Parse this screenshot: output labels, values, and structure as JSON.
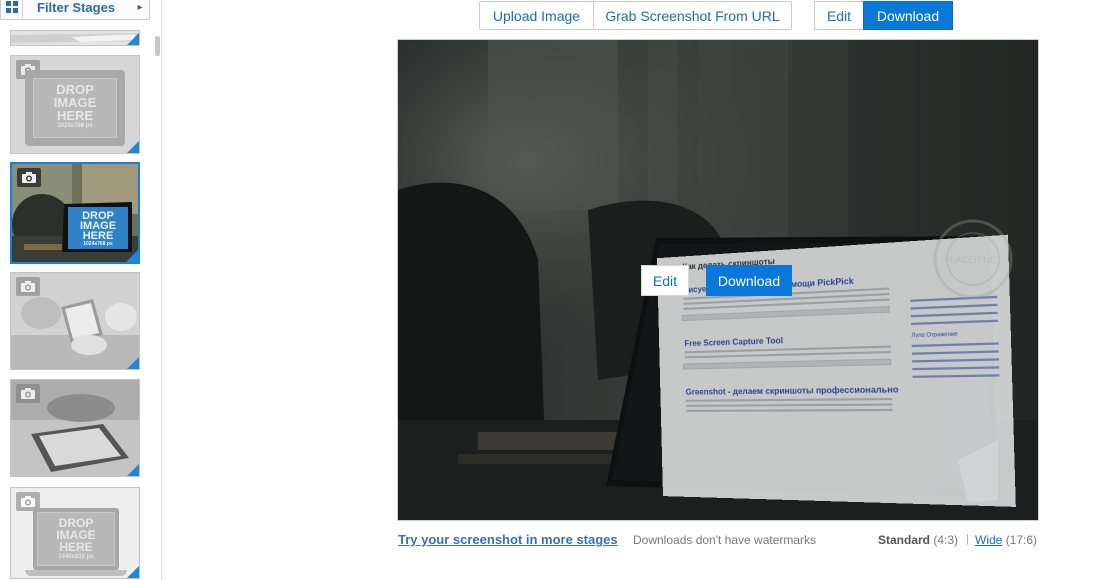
{
  "sidebar": {
    "filter_label": "Filter Stages",
    "filter_icon": "grid-icon",
    "filter_chevron": "chevron-right-icon",
    "placeholder": {
      "line1": "DROP",
      "line2": "IMAGE",
      "line3": "HERE"
    },
    "stages": [
      {
        "dims": "1024x768 px",
        "selected": false
      },
      {
        "dims": "1024x768 px",
        "selected": true
      },
      {
        "dims": "",
        "selected": false
      },
      {
        "dims": "",
        "selected": false
      },
      {
        "dims": "1440x810 px",
        "selected": false
      }
    ]
  },
  "toolbar": {
    "upload_label": "Upload Image",
    "grab_label": "Grab Screenshot From URL",
    "edit_label": "Edit",
    "download_label": "Download"
  },
  "preview": {
    "overlay_edit_label": "Edit",
    "overlay_download_label": "Download",
    "screen": {
      "blog_title": "Как делать скриншоты",
      "posts": [
        "Рисуем скриншоты при помощи PickPick",
        "Free Screen Capture Tool",
        "Greenshot - делаем скриншоты профессионально"
      ],
      "sidebar_title": "Лупа Отражение"
    },
    "watermark": "PLACEIT.NET"
  },
  "footer": {
    "try_link": "Try your screenshot in more stages",
    "watermark_note": "Downloads don't have watermarks",
    "standard_label": "Standard",
    "standard_ratio": "(4:3)",
    "separator": "|",
    "wide_label": "Wide",
    "wide_ratio": "(17:6)"
  },
  "colors": {
    "accent": "#0a78d8",
    "link": "#1a6cc0",
    "selected_border": "#1b7fd3"
  }
}
